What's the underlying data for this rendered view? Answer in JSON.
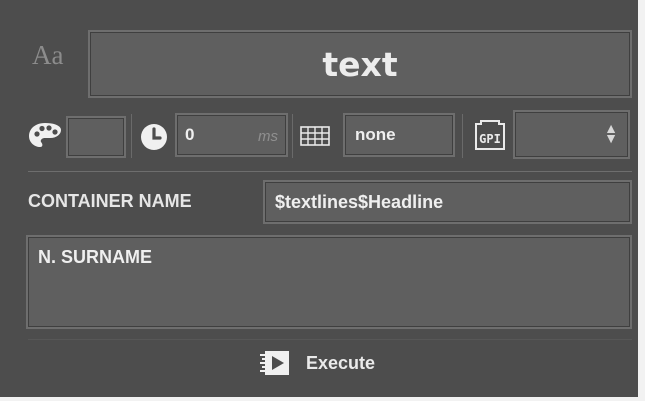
{
  "font_preview": {
    "label": "Aa"
  },
  "text_field": {
    "value": "text"
  },
  "toolbar": {
    "time": {
      "value": "0",
      "unit": "ms"
    },
    "table_field": {
      "value": "none"
    },
    "gpi_icon": "GPI",
    "gpi_select": {
      "value": ""
    }
  },
  "container": {
    "label": "CONTAINER NAME",
    "value": "$textlines$Headline"
  },
  "content": {
    "value": "N. SURNAME"
  },
  "execute": {
    "label": "Execute"
  },
  "icons": [
    "palette-icon",
    "clock-icon",
    "table-icon",
    "gpi-icon",
    "execute-icon",
    "updown-arrows-icon"
  ],
  "colors": {
    "panel": "#4d4d4d",
    "field": "#5f5f5f",
    "text": "#efefef"
  }
}
